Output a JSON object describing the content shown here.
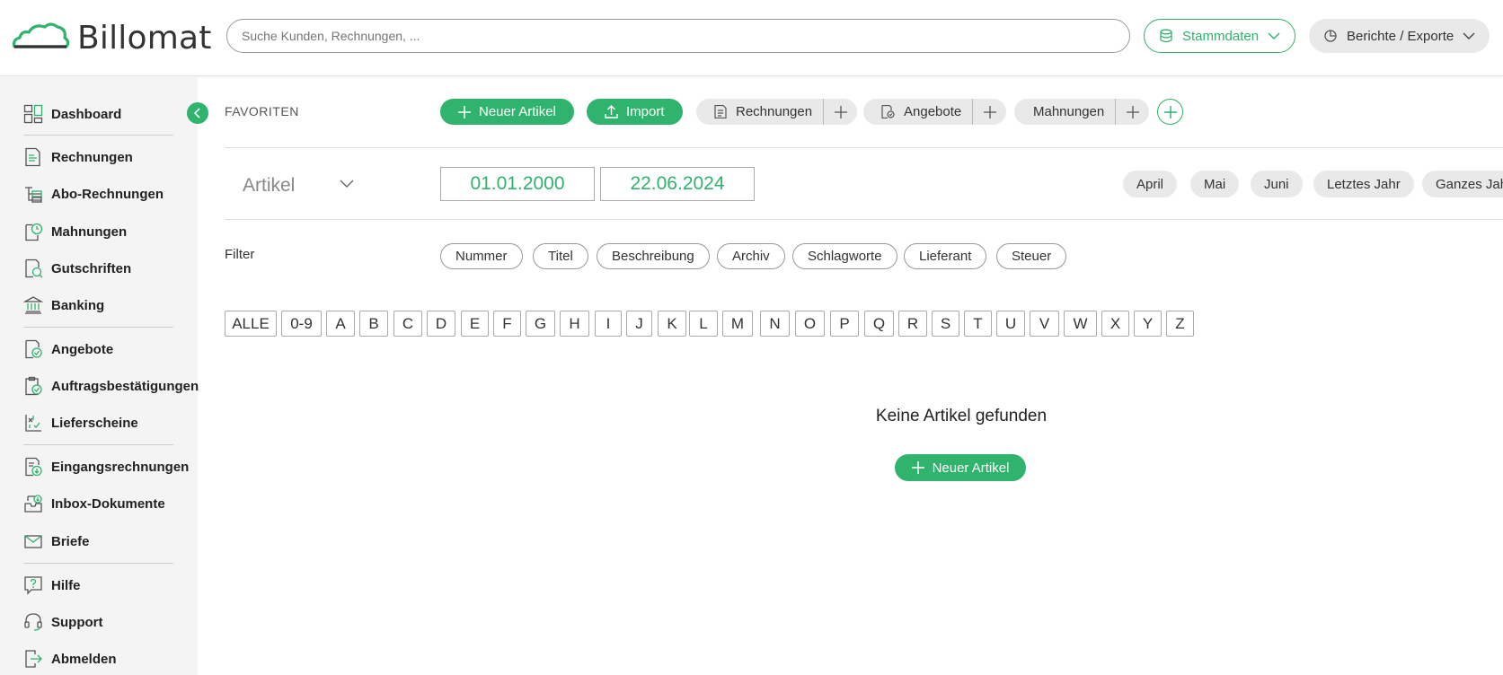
{
  "header": {
    "logo_text": "Billomat",
    "search_placeholder": "Suche Kunden, Rechnungen, ...",
    "stammdaten_label": "Stammdaten",
    "berichte_label": "Berichte / Exporte"
  },
  "sidebar": {
    "items": [
      {
        "label": "Dashboard",
        "icon": "dashboard-icon"
      },
      {
        "label": "Rechnungen",
        "icon": "invoice-icon"
      },
      {
        "label": "Abo-Rechnungen",
        "icon": "recurring-invoice-icon"
      },
      {
        "label": "Mahnungen",
        "icon": "reminder-icon"
      },
      {
        "label": "Gutschriften",
        "icon": "credit-note-icon"
      },
      {
        "label": "Banking",
        "icon": "bank-icon"
      },
      {
        "label": "Angebote",
        "icon": "offer-icon"
      },
      {
        "label": "Auftragsbestätigungen",
        "icon": "order-confirmation-icon"
      },
      {
        "label": "Lieferscheine",
        "icon": "delivery-note-icon"
      },
      {
        "label": "Eingangsrechnungen",
        "icon": "incoming-invoice-icon"
      },
      {
        "label": "Inbox-Dokumente",
        "icon": "inbox-icon"
      },
      {
        "label": "Briefe",
        "icon": "letter-icon"
      },
      {
        "label": "Hilfe",
        "icon": "help-icon"
      },
      {
        "label": "Support",
        "icon": "headset-icon"
      },
      {
        "label": "Abmelden",
        "icon": "logout-icon"
      }
    ]
  },
  "favorites": {
    "label": "FAVORITEN",
    "new_article": "Neuer Artikel",
    "import": "Import",
    "rechnungen": "Rechnungen",
    "angebote": "Angebote",
    "mahnungen": "Mahnungen"
  },
  "filterbar": {
    "type": "Artikel",
    "date_from": "01.01.2000",
    "date_to": "22.06.2024",
    "periods": [
      "April",
      "Mai",
      "Juni",
      "Letztes Jahr",
      "Ganzes Jahr"
    ]
  },
  "filter": {
    "label": "Filter",
    "chips": [
      "Nummer",
      "Titel",
      "Beschreibung",
      "Archiv",
      "Schlagworte",
      "Lieferant",
      "Steuer"
    ]
  },
  "alphabet": [
    "ALLE",
    "0-9",
    "A",
    "B",
    "C",
    "D",
    "E",
    "F",
    "G",
    "H",
    "I",
    "J",
    "K",
    "L",
    "M",
    "N",
    "O",
    "P",
    "Q",
    "R",
    "S",
    "T",
    "U",
    "V",
    "W",
    "X",
    "Y",
    "Z"
  ],
  "empty": {
    "title": "Keine Artikel gefunden",
    "button": "Neuer Artikel"
  },
  "colors": {
    "accent": "#2fb36d",
    "pill_grey": "#e9e9e9",
    "sidebar_bg": "#f4f4f4"
  }
}
